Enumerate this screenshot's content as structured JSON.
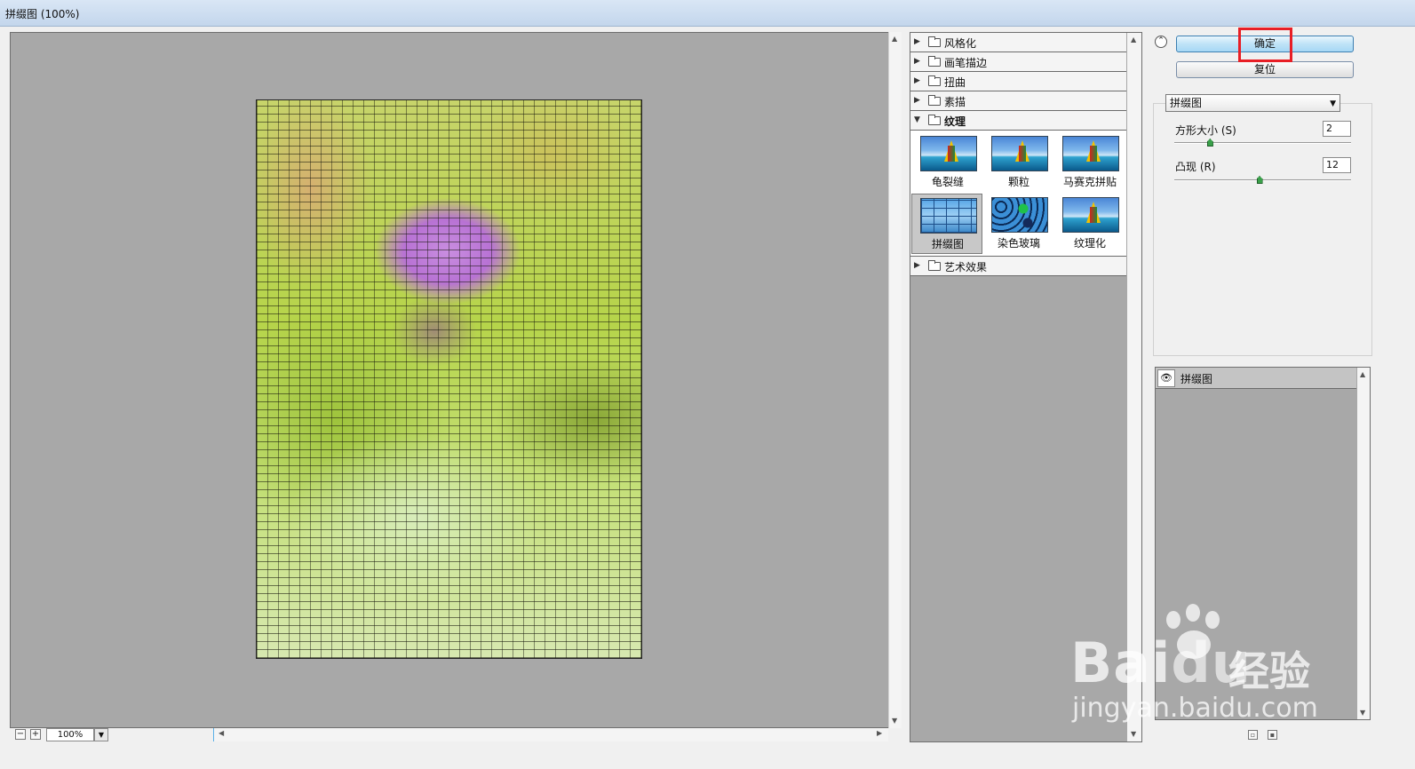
{
  "window": {
    "title": "拼缀图 (100%)"
  },
  "preview": {
    "zoom": "100%"
  },
  "filters": {
    "categories": [
      {
        "label": "风格化",
        "open": false
      },
      {
        "label": "画笔描边",
        "open": false
      },
      {
        "label": "扭曲",
        "open": false
      },
      {
        "label": "素描",
        "open": false
      },
      {
        "label": "纹理",
        "open": true
      },
      {
        "label": "艺术效果",
        "open": false
      }
    ],
    "texture_items": [
      {
        "label": "龟裂缝",
        "selected": false
      },
      {
        "label": "颗粒",
        "selected": false
      },
      {
        "label": "马赛克拼贴",
        "selected": false
      },
      {
        "label": "拼缀图",
        "selected": true
      },
      {
        "label": "染色玻璃",
        "selected": false
      },
      {
        "label": "纹理化",
        "selected": false
      }
    ]
  },
  "actions": {
    "ok_label": "确定",
    "reset_label": "复位"
  },
  "settings": {
    "filter_select": "拼缀图",
    "square_size": {
      "label": "方形大小",
      "mnemonic": "(S)",
      "value": "2",
      "level": 0.2
    },
    "relief": {
      "label": "凸现",
      "mnemonic": "(R)",
      "value": "12",
      "level": 0.48
    }
  },
  "layers": {
    "items": [
      {
        "name": "拼缀图",
        "visible": true
      }
    ]
  },
  "watermark": {
    "brand": "Bai",
    "brand_du": "du",
    "cn": "经验",
    "url": "jingyan.baidu.com"
  },
  "colors": {
    "highlight": "#e81e25",
    "ok_button": "#bfe3f7",
    "panel_gray": "#a8a8a8"
  }
}
